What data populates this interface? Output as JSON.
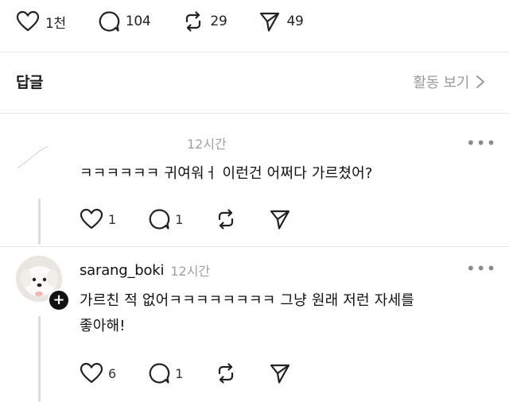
{
  "post_actions": {
    "like_count": "1천",
    "comment_count": "104",
    "repost_count": "29",
    "share_count": "49"
  },
  "replies": {
    "title": "답글",
    "activity_link": "활동 보기"
  },
  "comments": [
    {
      "username": "",
      "time": "12시간",
      "text": "ㅋㅋㅋㅋㅋㅋ 귀여워ㅓ 이런건 어쩌다 가르쳤어?",
      "like_count": "1",
      "reply_count": "1",
      "more": "•••"
    },
    {
      "username": "sarang_boki",
      "time": "12시간",
      "text_line1": "가르친 적 없어ㅋㅋㅋㅋㅋㅋㅋㅋ 그냥 원래 저런 자세를",
      "text_line2": "좋아해!",
      "like_count": "6",
      "reply_count": "1",
      "more": "•••"
    }
  ],
  "icons": {
    "like": "heart-icon",
    "comment": "comment-bubble-icon",
    "repost": "repost-icon",
    "share": "send-icon",
    "more": "more-dots-icon",
    "follow": "plus-icon",
    "chevron": "chevron-right-icon"
  }
}
